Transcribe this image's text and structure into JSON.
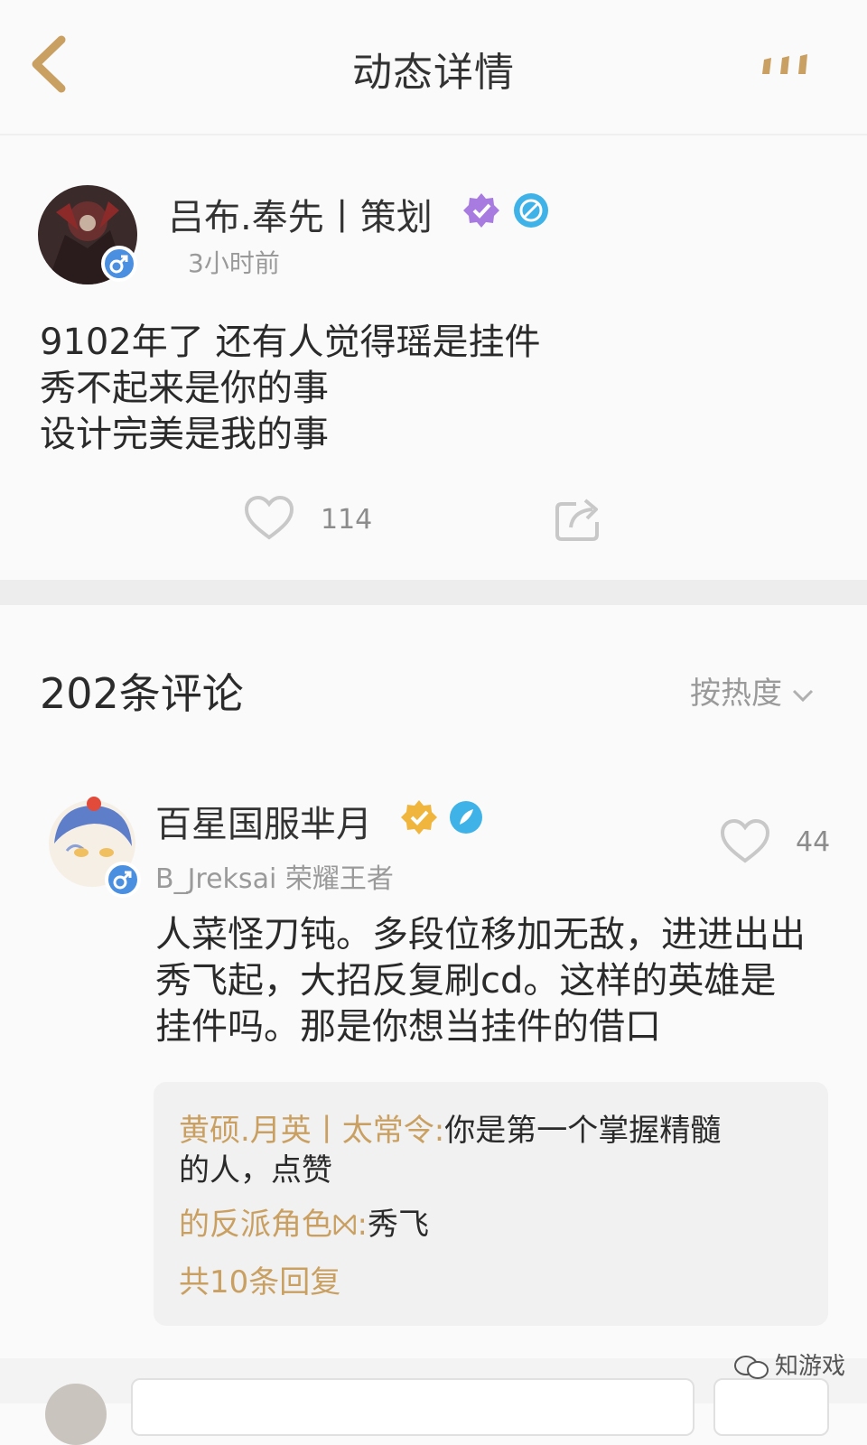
{
  "header": {
    "title": "动态详情",
    "back_icon": "chevron-left-icon",
    "more_icon": "more-icon"
  },
  "post": {
    "author": "吕布.奉先丨策划",
    "time": "3小时前",
    "lines": [
      "9102年了 还有人觉得瑶是挂件",
      "秀不起来是你的事",
      "设计完美是我的事"
    ],
    "like_count": "114"
  },
  "comments": {
    "title": "202条评论",
    "sort_label": "按热度",
    "items": [
      {
        "name": "百星国服芈月",
        "sub": "B_Jreksai 荣耀王者",
        "like_count": "44",
        "lines": [
          "人菜怪刀钝。多段位移加无敌，进进出出",
          "秀飞起，大招反复刷cd。这样的英雄是",
          "挂件吗。那是你想当挂件的借口"
        ],
        "replies": [
          {
            "author": "黄硕.月英丨太常令:",
            "text1": "你是第一个掌握精髓",
            "text2": "的人，点赞"
          },
          {
            "author": "的反派角色⨝:",
            "text1": "秀飞"
          }
        ],
        "more_replies": "共10条回复"
      }
    ]
  },
  "watermark": "知游戏",
  "colors": {
    "accent": "#c9a062",
    "verified_purple": "#a77be0",
    "verified_gold": "#f0b53c",
    "blue": "#3fb3e8"
  }
}
